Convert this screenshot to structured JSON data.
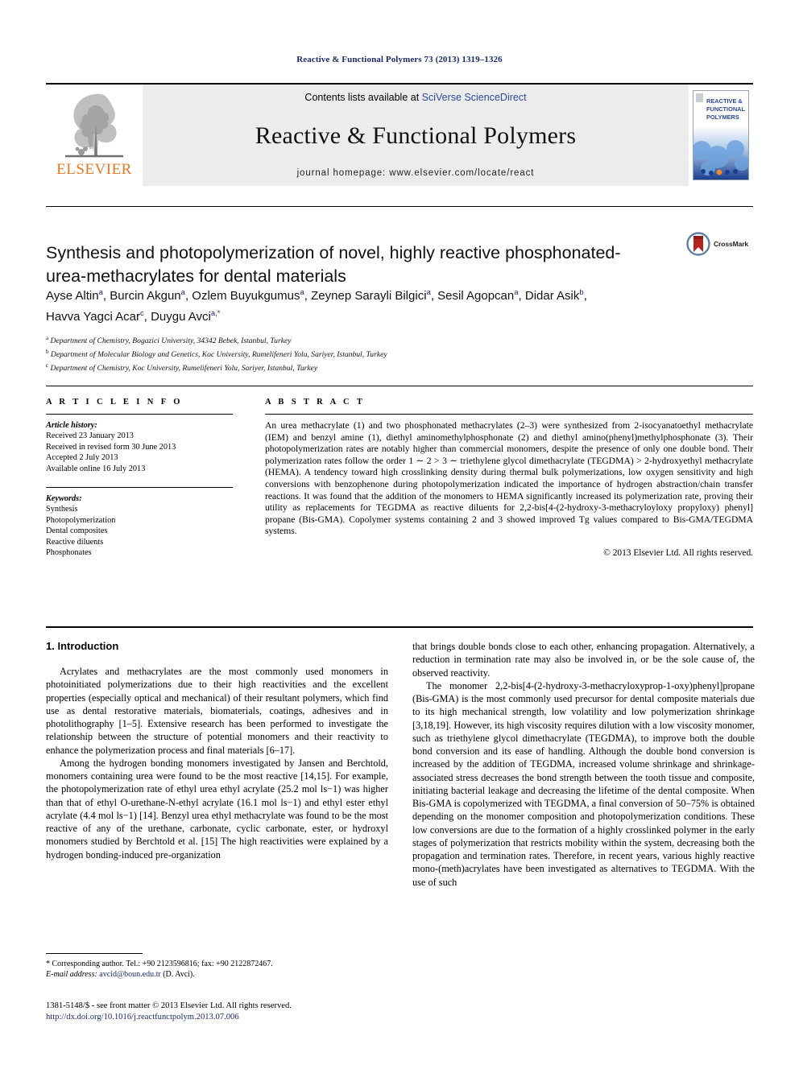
{
  "running_head": "Reactive & Functional Polymers 73 (2013) 1319–1326",
  "masthead": {
    "publisher": "ELSEVIER",
    "contents_prefix": "Contents lists available at ",
    "contents_link": "SciVerse ScienceDirect",
    "journal_title": "Reactive & Functional Polymers",
    "homepage": "journal homepage: www.elsevier.com/locate/react",
    "cover_line1": "REACTIVE &",
    "cover_line2": "FUNCTIONAL",
    "cover_line3": "POLYMERS"
  },
  "crossmark": {
    "label": "CrossMark"
  },
  "article": {
    "title": "Synthesis and photopolymerization of novel, highly reactive phosphonated-urea-methacrylates for dental materials",
    "authors_line1": "Ayse Altin a, Burcin Akgun a, Ozlem Buyukgumus a, Zeynep Sarayli Bilgici a, Sesil Agopcan a, Didar Asik b,",
    "authors_line2": "Havva Yagci Acar c, Duygu Avci a,*",
    "affiliations": [
      {
        "mark": "a",
        "text": "Department of Chemistry, Bogazici University, 34342 Bebek, Istanbul, Turkey"
      },
      {
        "mark": "b",
        "text": "Department of Molecular Biology and Genetics, Koc University, Rumelifeneri Yolu, Sariyer, Istanbul, Turkey"
      },
      {
        "mark": "c",
        "text": "Department of Chemistry, Koc University, Rumelifeneri Yolu, Sariyer, Istanbul, Turkey"
      }
    ]
  },
  "article_info": {
    "heading": "A R T I C L E    I N F O",
    "history_label": "Article history:",
    "history": [
      "Received 23 January 2013",
      "Received in revised form 30 June 2013",
      "Accepted 2 July 2013",
      "Available online 16 July 2013"
    ],
    "keywords_label": "Keywords:",
    "keywords": [
      "Synthesis",
      "Photopolymerization",
      "Dental composites",
      "Reactive diluents",
      "Phosphonates"
    ]
  },
  "abstract": {
    "heading": "A B S T R A C T",
    "text": "An urea methacrylate (1) and two phosphonated methacrylates (2–3) were synthesized from 2-isocyanatoethyl methacrylate (IEM) and benzyl amine (1), diethyl aminomethylphosphonate (2) and diethyl amino(phenyl)methylphosphonate (3). Their photopolymerization rates are notably higher than commercial monomers, despite the presence of only one double bond. Their polymerization rates follow the order 1 ∼ 2 > 3 ∼ triethylene glycol dimethacrylate (TEGDMA) > 2-hydroxyethyl methacrylate (HEMA). A tendency toward high crosslinking density during thermal bulk polymerizations, low oxygen sensitivity and high conversions with benzophenone during photopolymerization indicated the importance of hydrogen abstraction/chain transfer reactions. It was found that the addition of the monomers to HEMA significantly increased its polymerization rate, proving their utility as replacements for TEGDMA as reactive diluents for 2,2-bis[4-(2-hydroxy-3-methacryloyloxy propyloxy) phenyl] propane (Bis-GMA). Copolymer systems containing 2 and 3 showed improved Tg values compared to Bis-GMA/TEGDMA systems.",
    "copyright": "© 2013 Elsevier Ltd. All rights reserved."
  },
  "sections": {
    "intro_heading": "1. Introduction"
  },
  "body_left": [
    "Acrylates and methacrylates are the most commonly used monomers in photoinitiated polymerizations due to their high reactivities and the excellent properties (especially optical and mechanical) of their resultant polymers, which find use as dental restorative materials, biomaterials, coatings, adhesives and in photolithography [1–5]. Extensive research has been performed to investigate the relationship between the structure of potential monomers and their reactivity to enhance the polymerization process and final materials [6–17].",
    "Among the hydrogen bonding monomers investigated by Jansen and Berchtold, monomers containing urea were found to be the most reactive [14,15]. For example, the photopolymerization rate of ethyl urea ethyl acrylate (25.2 mol ls−1) was higher than that of ethyl O-urethane-N-ethyl acrylate (16.1 mol ls−1) and ethyl ester ethyl acrylate (4.4 mol ls−1) [14]. Benzyl urea ethyl methacrylate was found to be the most reactive of any of the urethane, carbonate, cyclic carbonate, ester, or hydroxyl monomers studied by Berchtold et al. [15] The high reactivities were explained by a hydrogen bonding-induced pre-organization"
  ],
  "body_right": [
    "that brings double bonds close to each other, enhancing propagation. Alternatively, a reduction in termination rate may also be involved in, or be the sole cause of, the observed reactivity.",
    "The monomer 2,2-bis[4-(2-hydroxy-3-methacryloxyprop-1-oxy)phenyl]propane (Bis-GMA) is the most commonly used precursor for dental composite materials due to its high mechanical strength, low volatility and low polymerization shrinkage [3,18,19]. However, its high viscosity requires dilution with a low viscosity monomer, such as triethylene glycol dimethacrylate (TEGDMA), to improve both the double bond conversion and its ease of handling. Although the double bond conversion is increased by the addition of TEGDMA, increased volume shrinkage and shrinkage-associated stress decreases the bond strength between the tooth tissue and composite, initiating bacterial leakage and decreasing the lifetime of the dental composite. When Bis-GMA is copolymerized with TEGDMA, a final conversion of 50–75% is obtained depending on the monomer composition and photopolymerization conditions. These low conversions are due to the formation of a highly crosslinked polymer in the early stages of polymerization that restricts mobility within the system, decreasing both the propagation and termination rates. Therefore, in recent years, various highly reactive mono-(meth)acrylates have been investigated as alternatives to TEGDMA. With the use of such"
  ],
  "footnote": {
    "corresponding": "* Corresponding author. Tel.: +90 2123596816; fax: +90 2122872467.",
    "email_label": "E-mail address:",
    "email": "avcid@boun.edu.tr",
    "email_suffix": "(D. Avci)."
  },
  "footer": {
    "issn_line": "1381-5148/$ - see front matter © 2013 Elsevier Ltd. All rights reserved.",
    "doi": "http://dx.doi.org/10.1016/j.reactfunctpolym.2013.07.006"
  },
  "colors": {
    "link_blue": "#2b4a9b",
    "dark_blue": "#1b2a6b",
    "elsevier_orange": "#E87722",
    "band_gray": "#ececec"
  }
}
